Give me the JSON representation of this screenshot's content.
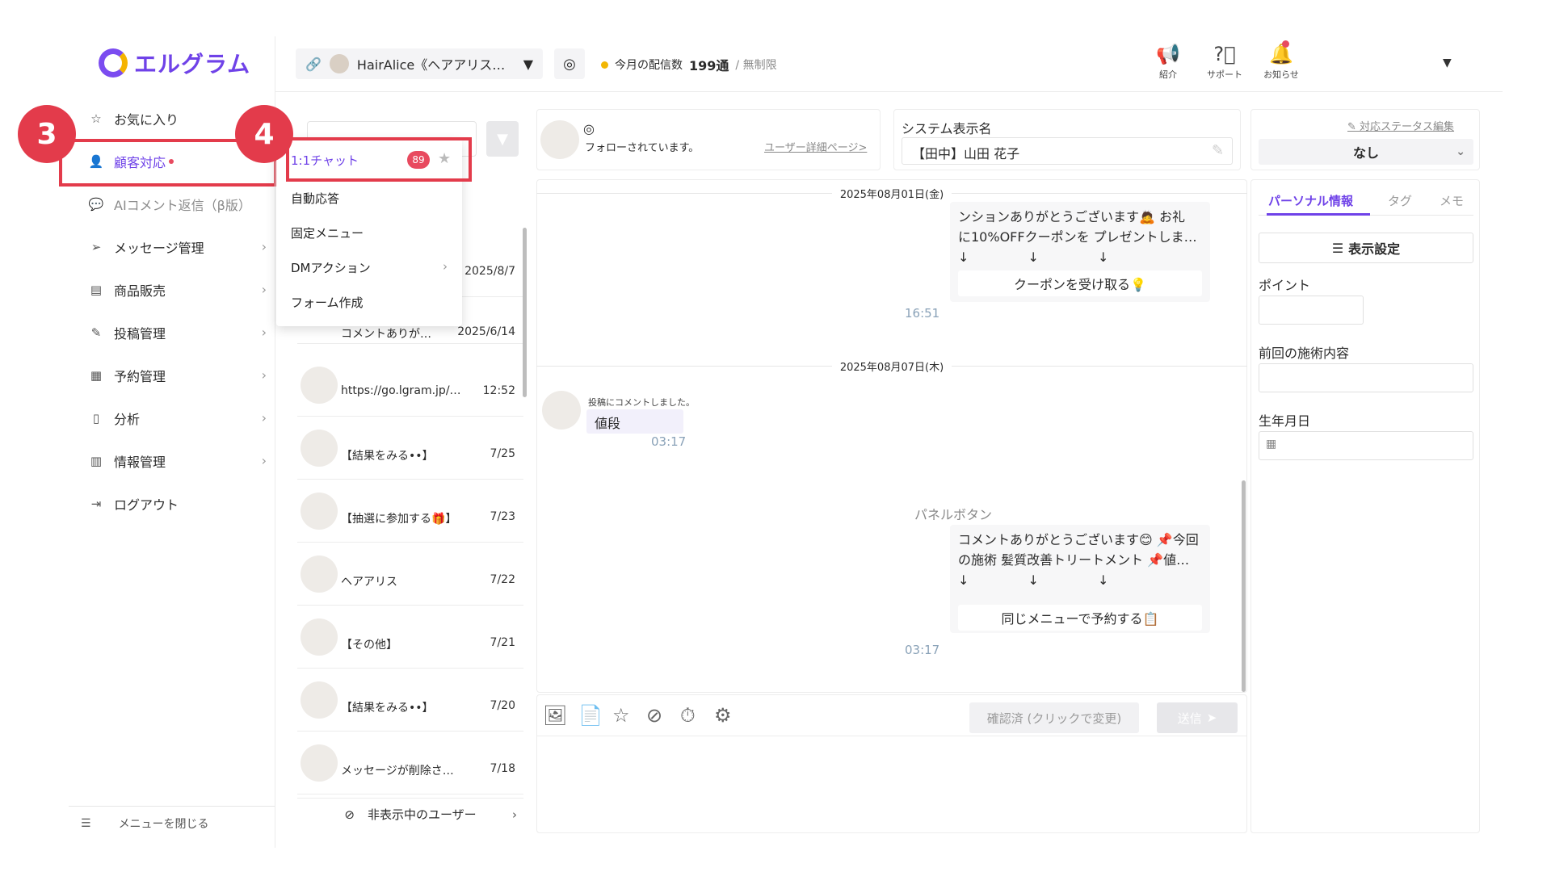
{
  "app": {
    "logo_text": "エルグラム",
    "brand_color": "#6f42e8",
    "accent_red": "#e33b4b"
  },
  "sidebar": {
    "items": [
      {
        "label": "お気に入り",
        "icon": "star-icon"
      },
      {
        "label": "顧客対応",
        "icon": "user-icon",
        "active": true
      },
      {
        "label": "AIコメント返信（β版）",
        "icon": "chat-ai-icon"
      },
      {
        "label": "メッセージ管理",
        "icon": "send-icon"
      },
      {
        "label": "商品販売",
        "icon": "shop-icon"
      },
      {
        "label": "投稿管理",
        "icon": "edit-icon"
      },
      {
        "label": "予約管理",
        "icon": "calendar-icon"
      },
      {
        "label": "分析",
        "icon": "report-icon"
      },
      {
        "label": "情報管理",
        "icon": "bar-chart-icon"
      },
      {
        "label": "ログアウト",
        "icon": "logout-icon"
      }
    ],
    "close_menu_label": "メニューを閉じる"
  },
  "annotations": {
    "step3": "3",
    "step4": "4"
  },
  "topbar": {
    "account_name": "HairAlice《ヘアアリス…",
    "delivery_label": "今月の配信数",
    "delivery_count": "199通",
    "delivery_limit": "/ 無制限",
    "icons": [
      {
        "label": "紹介",
        "icon": "megaphone-icon"
      },
      {
        "label": "サポート",
        "icon": "help-icon"
      },
      {
        "label": "お知らせ",
        "icon": "bell-icon"
      }
    ]
  },
  "dropdown": {
    "items": [
      "1:1チャット",
      "自動応答",
      "固定メニュー",
      "DMアクション",
      "フォーム作成"
    ],
    "chat_count": "89"
  },
  "chat_list": {
    "rows": [
      {
        "message": "",
        "date": "2025/8/7"
      },
      {
        "message": "コメントありが…",
        "date": "2025/6/14"
      },
      {
        "message": "https://go.lgram.jp/…",
        "date": "12:52"
      },
      {
        "message": "【結果をみる••】",
        "date": "7/25"
      },
      {
        "message": "【抽選に参加する🎁】",
        "date": "7/23"
      },
      {
        "message": "ヘアアリス",
        "date": "7/22"
      },
      {
        "message": "【その他】",
        "date": "7/21"
      },
      {
        "message": "【結果をみる••】",
        "date": "7/20"
      },
      {
        "message": "メッセージが削除さ…",
        "date": "7/18"
      }
    ],
    "hidden_users_label": "非表示中のユーザー"
  },
  "user_card": {
    "follow_status": "フォローされています。",
    "detail_link": "ユーザー詳細ページ>"
  },
  "system_name": {
    "label": "システム表示名",
    "value": "【田中】山田 花子"
  },
  "status": {
    "edit_label": "対応ステータス編集",
    "value": "なし"
  },
  "chat": {
    "date1": "2025年08月01日(金)",
    "msg1_line1": "ンションありがとうございます🙇 お礼",
    "msg1_line2": "に10%OFFクーポンを プレゼントしま…",
    "arrows": "↓ ↓ ↓",
    "msg1_button": "クーポンを受け取る💡",
    "msg1_time": "16:51",
    "date2": "2025年08月07日(木)",
    "comment_note": "投稿にコメントしました。",
    "comment_text": "値段",
    "comment_time": "03:17",
    "panel_label": "パネルボタン",
    "msg2_line1": "コメントありがとうございます😊 📌今回",
    "msg2_line2": "の施術 髪質改善トリートメント 📌値…",
    "msg2_button": "同じメニューで予約する📋",
    "msg2_time": "03:17"
  },
  "composer": {
    "confirm_label": "確認済 (クリックで変更)",
    "send_label": "送信"
  },
  "right_panel": {
    "tabs": [
      "パーソナル情報",
      "タグ",
      "メモ"
    ],
    "display_settings": "表示設定",
    "fields": [
      "ポイント",
      "前回の施術内容",
      "生年月日"
    ]
  }
}
